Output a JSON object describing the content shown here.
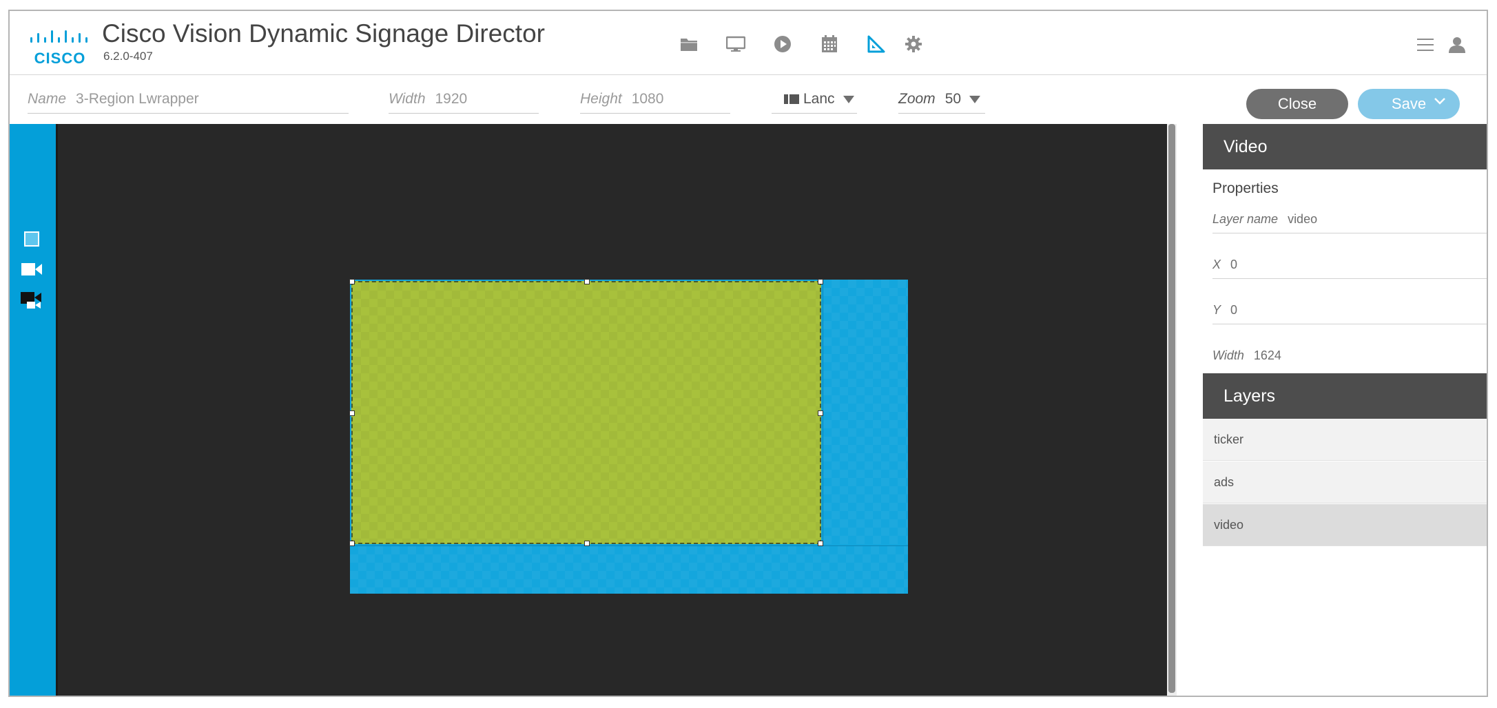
{
  "header": {
    "logo_text": "CISCO",
    "title": "Cisco Vision Dynamic Signage Director",
    "version": "6.2.0-407",
    "nav_icons": [
      "folder-icon",
      "monitor-icon",
      "play-icon",
      "calendar-icon",
      "layout-designer-icon",
      "gear-icon"
    ],
    "right_icons": [
      "menu-icon",
      "user-icon"
    ]
  },
  "toolbar": {
    "name_label": "Name",
    "name_value": "3-Region Lwrapper",
    "width_label": "Width",
    "width_value": "1920",
    "height_label": "Height",
    "height_value": "1080",
    "orientation_value": "Lanc",
    "zoom_label": "Zoom",
    "zoom_value": "50",
    "close_label": "Close",
    "save_label": "Save"
  },
  "rail": {
    "tools": [
      "region-icon",
      "video-icon",
      "multi-video-icon"
    ]
  },
  "canvas": {
    "regions": [
      "video",
      "ads",
      "ticker"
    ],
    "colors": {
      "video": "#a8c13c",
      "ads": "#14a6dd",
      "ticker": "#14a6dd",
      "background": "#282828"
    }
  },
  "properties_panel": {
    "header": "Video",
    "section_title": "Properties",
    "fields": [
      {
        "label": "Layer name",
        "value": "video"
      },
      {
        "label": "X",
        "value": "0"
      },
      {
        "label": "Y",
        "value": "0"
      },
      {
        "label": "Width",
        "value": "1624"
      }
    ]
  },
  "layers_panel": {
    "header": "Layers",
    "items": [
      {
        "label": "ticker",
        "selected": false
      },
      {
        "label": "ads",
        "selected": false
      },
      {
        "label": "video",
        "selected": true
      }
    ]
  },
  "theme": {
    "accent": "#049fd9",
    "panel_header": "#4d4d4d",
    "close_button": "#707070",
    "save_button": "#84c8e8"
  }
}
